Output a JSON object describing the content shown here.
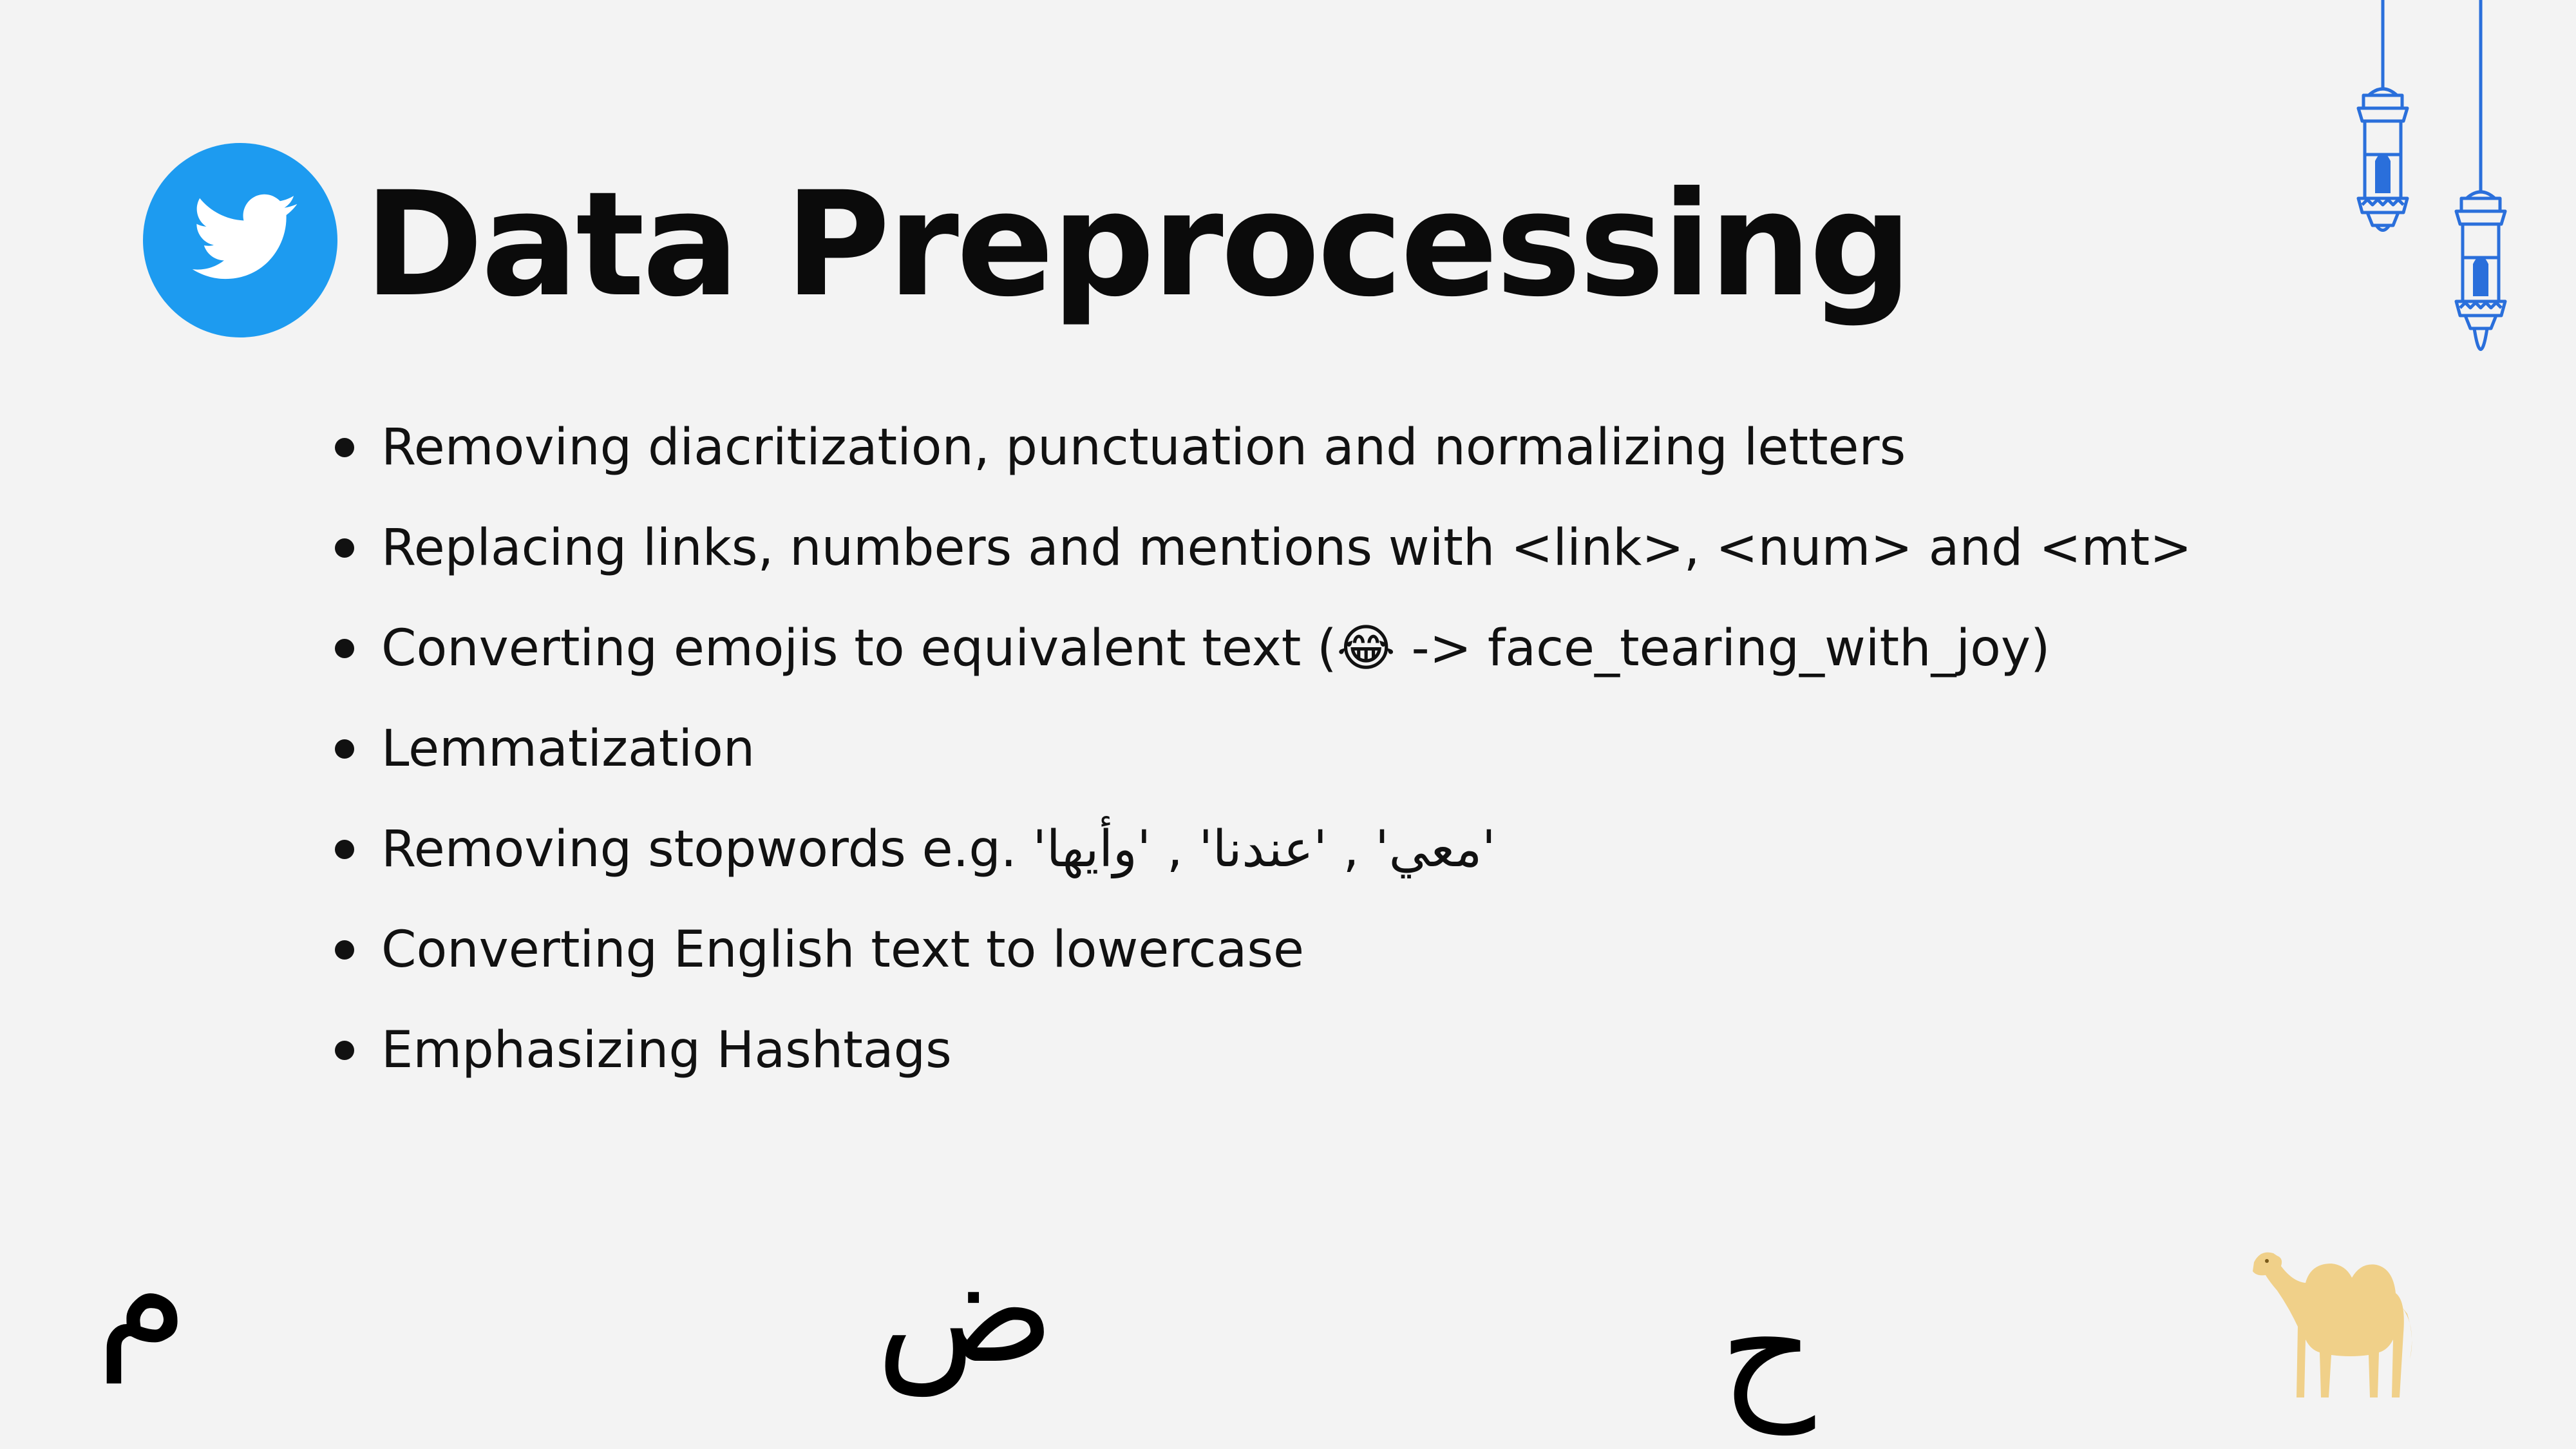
{
  "slide": {
    "title": "Data Preprocessing",
    "logo_icon": "twitter-bird-icon",
    "bullets": [
      "Removing diacritization, punctuation and normalizing letters",
      "Replacing links, numbers and mentions with <link>, <num> and <mt>",
      "Converting emojis to equivalent text (😂 -> face_tearing_with_joy)",
      "Lemmatization",
      "Removing stopwords e.g. 'معي' , 'عندنا' , 'وأيها'",
      "Converting English text to lowercase",
      "Emphasizing Hashtags"
    ]
  },
  "decorations": {
    "letters": [
      "م",
      "ض",
      "ح"
    ],
    "lantern_icon": "lantern-icon",
    "camel_icon": "camel-icon"
  },
  "colors": {
    "background": "#f3f3f3",
    "twitter_blue": "#1d9bf0",
    "lantern_blue": "#2a6fdb",
    "camel": "#f0d089"
  }
}
